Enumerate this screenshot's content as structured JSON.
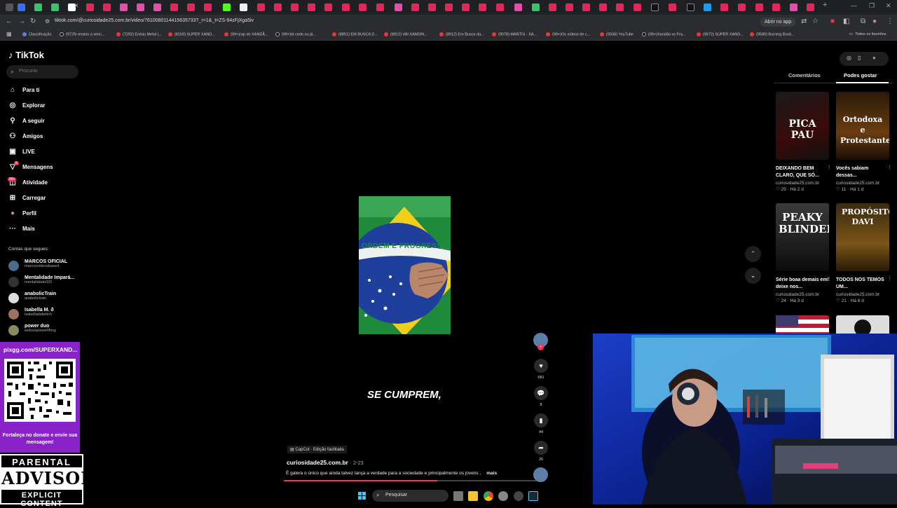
{
  "browser": {
    "url": "tiktok.com/@curiosidade25.com.br/video/7610080114415635733?_r=1&_t=ZS-94zFjXga5iv",
    "open_app_label": "Abrir no app",
    "bookmarks": [
      "Classificação",
      "(97)Te ensino a venc...",
      "(7292) Enéas Metal |...",
      "(8159) SUPER XAND...",
      "(99+)rap do XANDÃ...",
      "(99+)tá cedo ou já...",
      "(8851) EM BUSCA D...",
      "(8912) VAI XANDIN...",
      "(8912) Em Busca da...",
      "(9078) MANTIS - XA...",
      "(99+)Os vídeos de c...",
      "(9338) YouTube",
      "(99+)Xandão vs Fra...",
      "(9572) SUPER XAND...",
      "(9580) Burning Bord...",
      "Todos os favoritos"
    ]
  },
  "tiktok": {
    "logo": "TikTok",
    "search_placeholder": "Procurar",
    "nav": [
      {
        "label": "Para ti",
        "icon": "home-icon"
      },
      {
        "label": "Explorar",
        "icon": "compass-icon"
      },
      {
        "label": "A seguir",
        "icon": "following-icon"
      },
      {
        "label": "Amigos",
        "icon": "friends-icon"
      },
      {
        "label": "LIVE",
        "icon": "live-icon"
      },
      {
        "label": "Mensagens",
        "icon": "messages-icon",
        "badge": "6"
      },
      {
        "label": "Atividade",
        "icon": "activity-icon",
        "badge": "99+"
      },
      {
        "label": "Carregar",
        "icon": "upload-icon"
      },
      {
        "label": "Perfil",
        "icon": "profile-icon"
      },
      {
        "label": "Mais",
        "icon": "more-icon"
      }
    ],
    "following_title": "Contas que segues",
    "accounts": [
      {
        "name": "MARCOS OFICIAL",
        "handle": "marcosvideosbased"
      },
      {
        "name": "Mentalidade Impará...",
        "handle": "mentalidade020"
      },
      {
        "name": "anabolicTrain",
        "handle": "anabolictrain"
      },
      {
        "name": "Isabella M. ð",
        "handle": "isabelladatwitch"
      },
      {
        "name": "power duo",
        "handle": "welovepowerlifting"
      }
    ]
  },
  "video": {
    "flag_text": "ORDEM E PROGRESSO",
    "subtitle": "SE CUMPREM,",
    "capcut_label": "CapCut · Edição facilitada",
    "author": "curiosidade25.com.br",
    "date": "· 2-23",
    "caption": "É galera o único que ainda talvez lança a verdade para a sociedade e principalmente os jovens ,",
    "more_label": "mais",
    "progress": 0.59,
    "likes": "681",
    "comments": "8",
    "saves": "44",
    "shares": "26"
  },
  "right_panel": {
    "tab_comments": "Comentários",
    "tab_suggested": "Podes gostar",
    "cards": [
      {
        "thumb_text": "PICA PAU",
        "title": "DEIXANDO BEM CLARO, QUE SÓ...",
        "author": "curiosidade25.com.br",
        "likes": "25",
        "age": "Há 2 d",
        "accent": "#c8161d"
      },
      {
        "thumb_text": "Ortodoxa e Protestante",
        "title": "Vocês sabiam dessas...",
        "author": "curiosidade25.com.br",
        "likes": "11",
        "age": "Há 1 d",
        "accent": "#e8c27a"
      },
      {
        "thumb_text": "PEAKY BLINDERS",
        "title": "Série boaa demais em! deixe nos...",
        "author": "curiosidade25.com.br",
        "likes": "24",
        "age": "Há 3 d",
        "accent": "#e5e5e5"
      },
      {
        "thumb_text": "PROPÓSITO DAVI",
        "title": "TODOS NÓS TEMOS UM...",
        "author": "curiosidade25.com.br",
        "likes": "21",
        "age": "Há 6 d",
        "accent": "#f3d38a"
      }
    ]
  },
  "overlay": {
    "qr_url": "pixgg.com/SUPERXAND...",
    "qr_text": "Fortaleça no donate e envie sua mensagem!",
    "advisory_top": "PARENTAL",
    "advisory_mid": "ADVISORY",
    "advisory_bottom": "EXPLICIT CONTENT"
  },
  "taskbar": {
    "search_label": "Pesquisar"
  }
}
